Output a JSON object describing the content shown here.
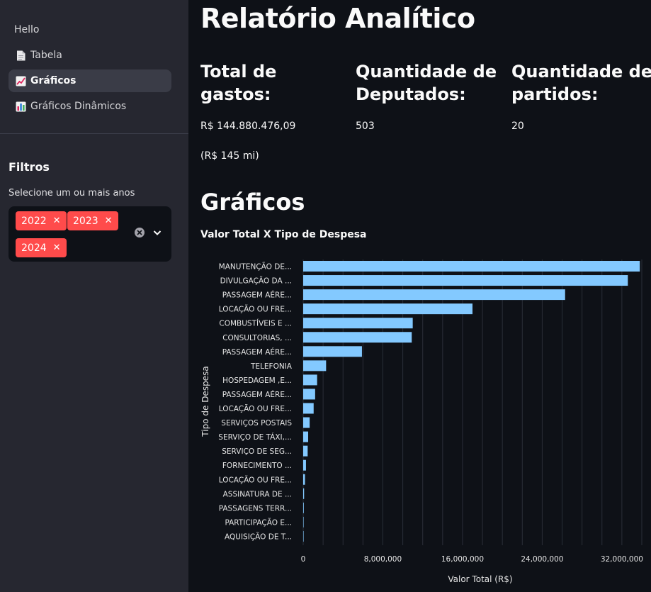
{
  "sidebar": {
    "nav": [
      {
        "label": "Hello",
        "icon": "",
        "active": false
      },
      {
        "label": "Tabela",
        "icon": "page-icon",
        "active": false
      },
      {
        "label": "Gráficos",
        "icon": "chart-increasing-icon",
        "active": true
      },
      {
        "label": "Gráficos Dinâmicos",
        "icon": "bar-chart-icon",
        "active": false
      }
    ],
    "filters_title": "Filtros",
    "year_select": {
      "label": "Selecione um ou mais anos",
      "selected": [
        "2022",
        "2023",
        "2024"
      ],
      "remove_glyph": "✕"
    }
  },
  "main": {
    "title": "Relatório Analítico",
    "metrics": [
      {
        "label": "Total de gastos:",
        "value": "R$ 144.880.476,09",
        "sub": "(R$ 145 mi)"
      },
      {
        "label": "Quantidade de Deputados:",
        "value": "503"
      },
      {
        "label": "Quantidade de partidos:",
        "value": "20"
      }
    ],
    "section_title": "Gráficos"
  },
  "colors": {
    "bar": "#83c9ff",
    "accent": "#ff4b4b",
    "sidebar_bg": "#262730",
    "page_bg": "#0e1117"
  },
  "chart_data": {
    "type": "bar",
    "orientation": "horizontal",
    "title": "Valor Total X Tipo de Despesa",
    "xlabel": "Valor Total (R$)",
    "ylabel": "Tipo de Despesa",
    "xlim": [
      0,
      34000000
    ],
    "xticks": [
      0,
      8000000,
      16000000,
      24000000,
      32000000
    ],
    "xtick_labels": [
      "0",
      "8,000,000",
      "16,000,000",
      "24,000,000",
      "32,000,000"
    ],
    "grid": true,
    "categories": [
      "MANUTENÇÃO DE...",
      "DIVULGAÇÃO DA ...",
      "PASSAGEM AÉRE...",
      "LOCAÇÃO OU FRE...",
      "COMBUSTÍVEIS E ...",
      "CONSULTORIAS, ...",
      "PASSAGEM AÉRE...",
      "TELEFONIA",
      "HOSPEDAGEM ,E...",
      "PASSAGEM AÉRE...",
      "LOCAÇÃO OU FRE...",
      "SERVIÇOS POSTAIS",
      "SERVIÇO DE TÁXI,...",
      "SERVIÇO DE SEG...",
      "FORNECIMENTO ...",
      "LOCAÇÃO OU FRE...",
      "ASSINATURA DE ...",
      "PASSAGENS TERR...",
      "PARTICIPAÇÃO E...",
      "AQUISIÇÃO DE T..."
    ],
    "values": [
      33800000,
      32600000,
      26300000,
      17000000,
      11000000,
      10900000,
      5900000,
      2300000,
      1400000,
      1200000,
      1050000,
      650000,
      500000,
      450000,
      280000,
      180000,
      90000,
      60000,
      10000,
      5000
    ]
  }
}
